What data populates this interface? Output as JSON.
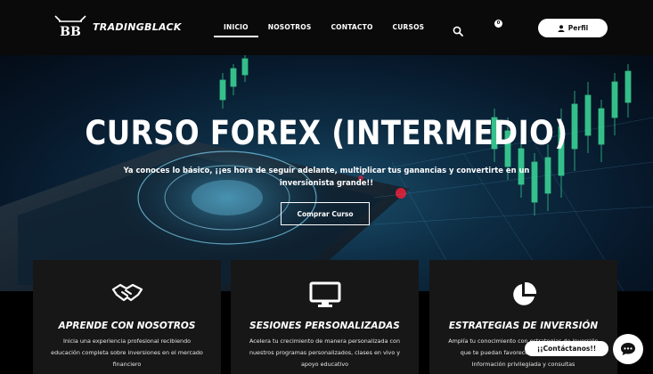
{
  "brand": {
    "name": "TRADINGBLACK"
  },
  "nav": {
    "items": [
      {
        "label": "INICIO",
        "active": true
      },
      {
        "label": "NOSOTROS",
        "active": false
      },
      {
        "label": "CONTACTO",
        "active": false
      },
      {
        "label": "CURSOS",
        "active": false
      }
    ]
  },
  "header": {
    "search_icon": "search-icon",
    "cart_count": "0",
    "profile_label": "Perfil"
  },
  "hero": {
    "title": "CURSO FOREX (INTERMEDIO)",
    "subtitle": "Ya conoces lo básico, ¡¡es hora de seguir adelante, multiplicar tus ganancias y convertirte en un inversionista grande!!",
    "button_label": "Comprar Curso"
  },
  "cards": [
    {
      "icon": "handshake-icon",
      "title": "APRENDE CON NOSOTROS",
      "desc": "Inicia una experiencia profesional recibiendo educación completa sobre inversiones en el mercado financiero"
    },
    {
      "icon": "monitor-icon",
      "title": "SESIONES PERSONALIZADAS",
      "desc": "Acelera tu crecimiento de manera personalizada con nuestros programas personalizados, clases en vivo y apoyo educativo"
    },
    {
      "icon": "pie-chart-icon",
      "title": "ESTRATEGIAS DE INVERSIÓN",
      "desc": "Amplía tu conocimiento con estrategias de inversión que te puedan favorecer en tus inversiones. Información privilegiada y consultas"
    }
  ],
  "chat": {
    "label": "¡¡Contáctanos!!"
  },
  "colors": {
    "header_bg": "#0a0a0a",
    "card_bg": "#171717",
    "accent_green": "#3ddc9a",
    "accent_red": "#e0203a"
  }
}
